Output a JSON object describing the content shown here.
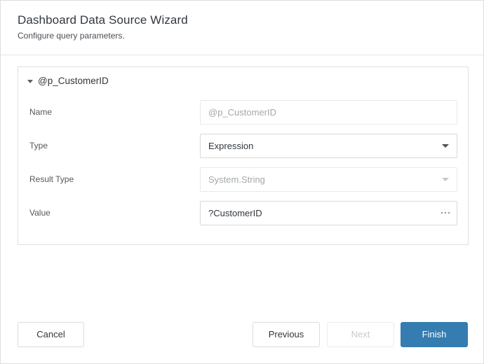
{
  "header": {
    "title": "Dashboard Data Source Wizard",
    "subtitle": "Configure query parameters."
  },
  "panel": {
    "group_title": "@p_CustomerID",
    "collapse_icon": "triangle-down-icon",
    "rows": [
      {
        "label": "Name",
        "value": "",
        "placeholder": "@p_CustomerID",
        "control": "text",
        "state": "placeholder"
      },
      {
        "label": "Type",
        "value": "Expression",
        "placeholder": "",
        "control": "dropdown",
        "state": "enabled"
      },
      {
        "label": "Result Type",
        "value": "System.String",
        "placeholder": "",
        "control": "dropdown",
        "state": "disabled"
      },
      {
        "label": "Value",
        "value": "?CustomerID",
        "placeholder": "",
        "control": "text-with-ellipsis",
        "state": "enabled",
        "ellipsis_label": "ellipsis-button"
      }
    ]
  },
  "footer": {
    "cancel_label": "Cancel",
    "previous_label": "Previous",
    "next_label": "Next",
    "finish_label": "Finish"
  },
  "colors": {
    "primary": "#357cb0",
    "text": "#31373d",
    "muted_text": "#a3a8ad",
    "border": "#d9d9d9",
    "panel_border": "#e0e0e0"
  }
}
